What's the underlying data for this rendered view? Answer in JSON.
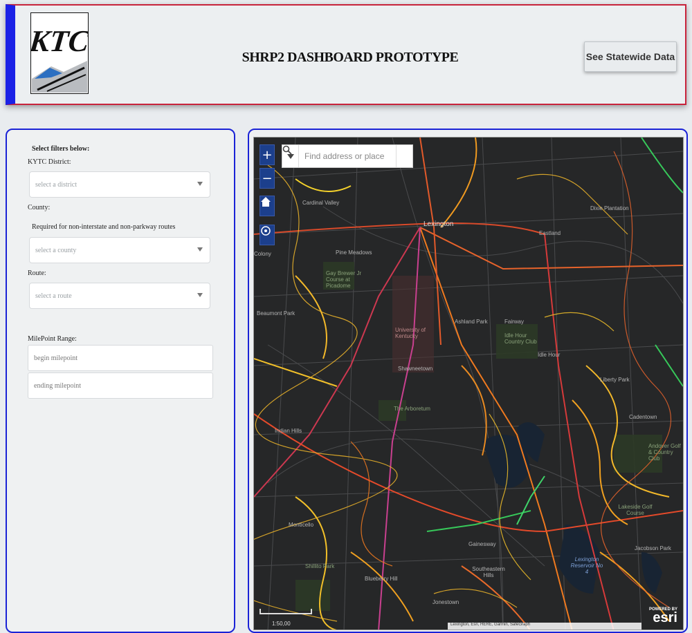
{
  "header": {
    "title": "SHRP2 DASHBOARD PROTOTYPE",
    "statewide_button": "See Statewide Data",
    "logo_text": "KTC"
  },
  "filters": {
    "heading": "Select filters below:",
    "district_label": "KYTC District:",
    "district_placeholder": "select a district",
    "county_label": "County:",
    "county_note": "Required for non-interstate and non-parkway routes",
    "county_placeholder": "select a county",
    "route_label": "Route:",
    "route_placeholder": "select a route",
    "milepoint_label": "MilePoint Range:",
    "begin_placeholder": "begin milepoint",
    "end_placeholder": "ending milepoint"
  },
  "map": {
    "search_placeholder": "Find address or place",
    "zoom_in": "+",
    "zoom_out": "−",
    "scale_text": "1:50,00",
    "powered_by": "POWERED BY",
    "esri": "esri",
    "attribution": "Lexington, Esri, HERE, Garmin, SafeGraph",
    "labels": [
      {
        "text": "Cardinal Valley"
      },
      {
        "text": "Lexington"
      },
      {
        "text": "Pine Meadows"
      },
      {
        "text": "Gay Brewer Jr Course at Picadome"
      },
      {
        "text": "Beaumont Park"
      },
      {
        "text": "University of Kentucky"
      },
      {
        "text": "Ashland Park"
      },
      {
        "text": "Fairway"
      },
      {
        "text": "Idle Hour Country Club"
      },
      {
        "text": "Idle Hour"
      },
      {
        "text": "Shawneetown"
      },
      {
        "text": "The Arboretum"
      },
      {
        "text": "Indian Hills"
      },
      {
        "text": "Liberty Park"
      },
      {
        "text": "Cadentown"
      },
      {
        "text": "Andover Golf & Country Club"
      },
      {
        "text": "Lakeside Golf Course"
      },
      {
        "text": "Jacobson Park"
      },
      {
        "text": "Monticello"
      },
      {
        "text": "Shillito Park"
      },
      {
        "text": "Blueberry Hill"
      },
      {
        "text": "Gainesway"
      },
      {
        "text": "Southeastern Hills"
      },
      {
        "text": "Jonestown"
      },
      {
        "text": "Eastland"
      },
      {
        "text": "Dixie Plantation"
      },
      {
        "text": "Colony"
      }
    ],
    "water_label": "Lexington Reservoir No 4"
  },
  "colors": {
    "accent_blue": "#1a22d6",
    "header_red": "#c8233b",
    "map_bg": "#262728"
  }
}
